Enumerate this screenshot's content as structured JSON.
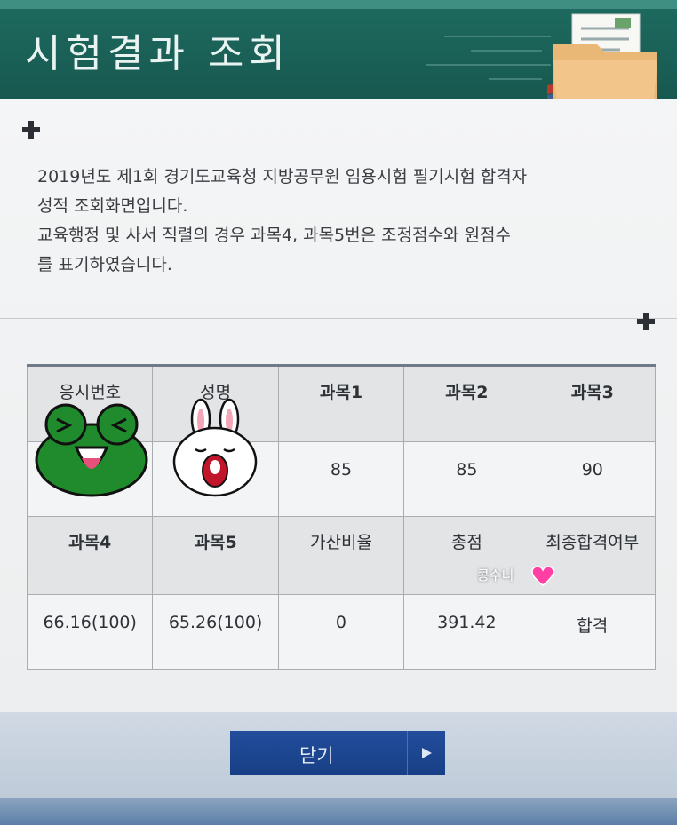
{
  "header": {
    "title": "시험결과 조회",
    "colors": {
      "band": "#1e6b60",
      "accent": "#3f8f82"
    },
    "icon": "folder-icon"
  },
  "notice": {
    "line1": "2019년도 제1회 경기도교육청 지방공무원 임용시험 필기시험 합격자",
    "line2": " 성적 조회화면입니다.",
    "line3": "교육행정 및 사서 직렬의 경우 과목4, 과목5번은 조정점수와 원점수",
    "line4": "를 표기하였습니다."
  },
  "table": {
    "row1_headers": [
      "응시번호",
      "성명",
      "과목1",
      "과목2",
      "과목3"
    ],
    "row1_values": [
      "",
      "",
      "85",
      "85",
      "90"
    ],
    "row2_headers": [
      "과목4",
      "과목5",
      "가산비율",
      "총점",
      "최종합격여부"
    ],
    "row2_values": [
      "66.16(100)",
      "65.26(100)",
      "0",
      "391.42",
      "합격"
    ],
    "redactions": [
      "frog-sticker",
      "rabbit-sticker"
    ]
  },
  "overlay": {
    "caption": "콩수니",
    "icon": "heart-icon"
  },
  "footer": {
    "close_label": "닫기",
    "arrow_icon": "play-arrow-icon",
    "colors": {
      "button": "#224d9b"
    }
  }
}
